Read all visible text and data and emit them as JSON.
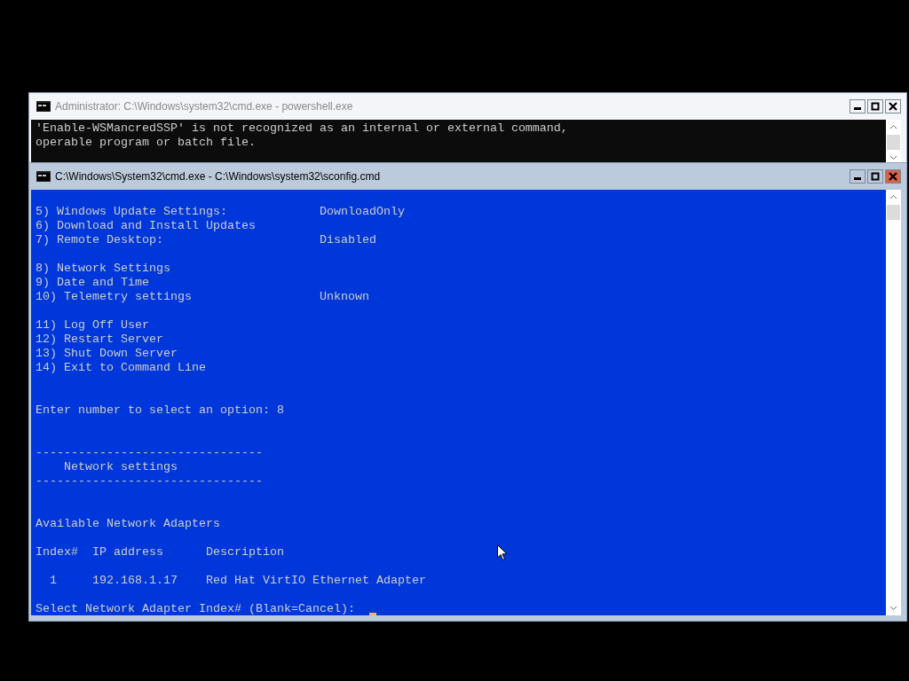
{
  "windows": [
    {
      "title": "Administrator: C:\\Windows\\system32\\cmd.exe - powershell.exe",
      "active": false,
      "kind": "dark",
      "lines": [
        {
          "kind": "text",
          "text": "'Enable-WSMancredSSP' is not recognized as an internal or external command,"
        },
        {
          "kind": "text",
          "text": "operable program or batch file."
        }
      ]
    },
    {
      "title": "C:\\Windows\\System32\\cmd.exe - C:\\Windows\\system32\\sconfig.cmd",
      "active": true,
      "kind": "blue",
      "lines": [
        {
          "kind": "item",
          "text": "5) Windows Update Settings:",
          "value": "DownloadOnly"
        },
        {
          "kind": "item",
          "text": "6) Download and Install Updates"
        },
        {
          "kind": "item",
          "text": "7) Remote Desktop:",
          "value": "Disabled"
        },
        {
          "kind": "blank"
        },
        {
          "kind": "item",
          "text": "8) Network Settings"
        },
        {
          "kind": "item",
          "text": "9) Date and Time"
        },
        {
          "kind": "item",
          "text": "10) Telemetry settings",
          "value": "Unknown"
        },
        {
          "kind": "blank"
        },
        {
          "kind": "item",
          "text": "11) Log Off User"
        },
        {
          "kind": "item",
          "text": "12) Restart Server"
        },
        {
          "kind": "item",
          "text": "13) Shut Down Server"
        },
        {
          "kind": "item",
          "text": "14) Exit to Command Line"
        },
        {
          "kind": "blank"
        },
        {
          "kind": "blank"
        },
        {
          "kind": "text",
          "text": "Enter number to select an option: 8"
        },
        {
          "kind": "blank"
        },
        {
          "kind": "blank"
        },
        {
          "kind": "text",
          "text": "--------------------------------"
        },
        {
          "kind": "text",
          "text": "    Network settings"
        },
        {
          "kind": "text",
          "text": "--------------------------------"
        },
        {
          "kind": "blank"
        },
        {
          "kind": "blank"
        },
        {
          "kind": "text",
          "text": "Available Network Adapters"
        },
        {
          "kind": "blank"
        },
        {
          "kind": "text",
          "text": "Index#  IP address      Description"
        },
        {
          "kind": "blank"
        },
        {
          "kind": "text",
          "text": "  1     192.168.1.17    Red Hat VirtIO Ethernet Adapter"
        },
        {
          "kind": "blank"
        },
        {
          "kind": "prompt",
          "text": "Select Network Adapter Index# (Blank=Cancel):",
          "cursor": true
        }
      ]
    }
  ]
}
